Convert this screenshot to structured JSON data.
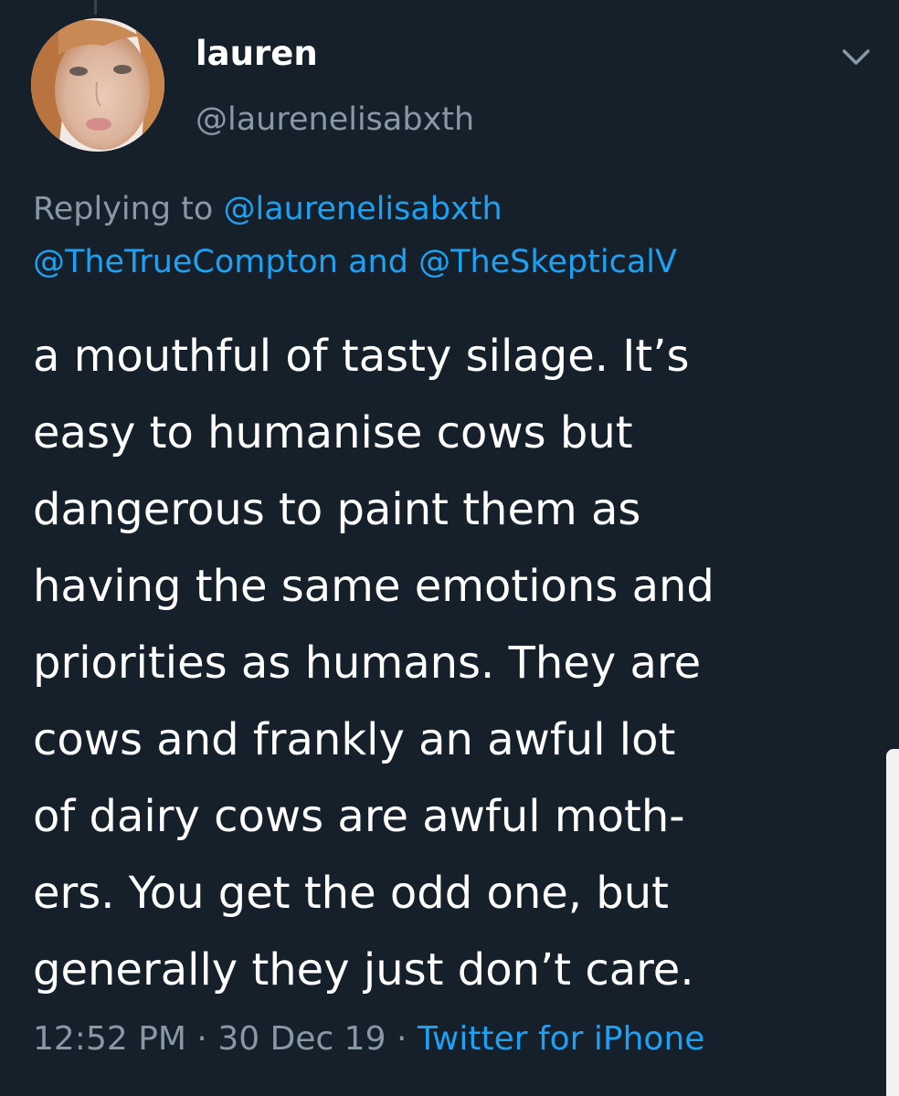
{
  "author": {
    "display_name": "lauren",
    "handle": "@laurenelisabxth"
  },
  "reply_context": {
    "prefix": "Replying to",
    "mention_1": "@laurenelisabxth",
    "mention_2": "@TheTrueCompton",
    "conjunction": "and",
    "mention_3": "@TheSkepticalV"
  },
  "tweet": {
    "lines": [
      "a mouthful of tasty silage. It’s",
      "easy to humanise cows but",
      "dangerous to paint them as",
      "having the same emotions and",
      "priorities as humans. They are",
      "cows and frankly an awful lot",
      "of dairy cows are awful moth-",
      "ers. You get the odd one, but",
      "generally they just don’t care."
    ]
  },
  "meta": {
    "time": "12:52 PM",
    "separator": "·",
    "date": "30 Dec 19",
    "source": "Twitter for iPhone"
  },
  "icons": {
    "more": "chevron-down-icon",
    "avatar": "profile-photo"
  },
  "colors": {
    "background": "#15202b",
    "primary_text": "#ffffff",
    "secondary_text": "#8899a6",
    "link": "#1da1f2"
  }
}
